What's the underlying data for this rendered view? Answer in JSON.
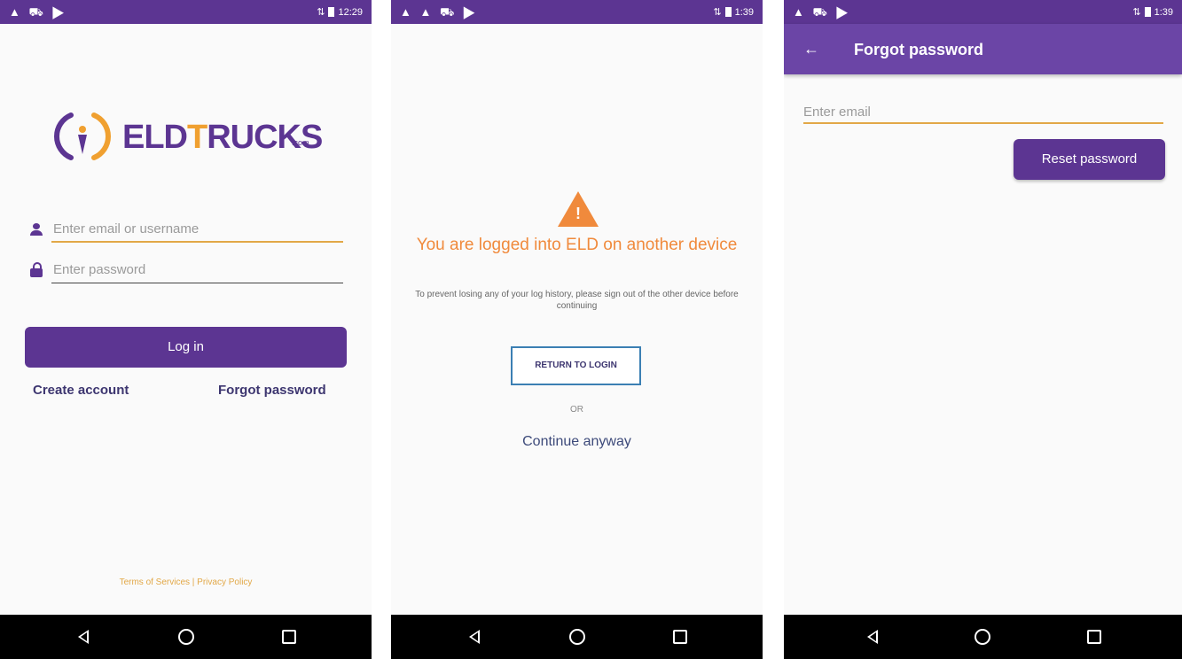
{
  "screens": {
    "login": {
      "status_time": "12:29",
      "logo": {
        "brand": "ELD",
        "brand_accent": "T",
        "brand_rest": "RUCKS",
        "suffix": ".com"
      },
      "email_placeholder": "Enter email or username",
      "password_placeholder": "Enter password",
      "login_button": "Log in",
      "create_account": "Create account",
      "forgot_password": "Forgot password",
      "footer": "Terms of Services | Privacy Policy"
    },
    "logged_in_elsewhere": {
      "status_time": "1:39",
      "title": "You are logged into ELD on another device",
      "subtitle": "To prevent losing any of your log history, please sign out of the other device before continuing",
      "return_button": "RETURN TO LOGIN",
      "or": "OR",
      "continue": "Continue anyway"
    },
    "forgot": {
      "status_time": "1:39",
      "title": "Forgot password",
      "email_placeholder": "Enter email",
      "reset_button": "Reset password"
    }
  },
  "colors": {
    "primary": "#5c3592",
    "accent": "#e2a847",
    "warning": "#f08a3c"
  },
  "icons": [
    "user-icon",
    "lock-icon",
    "warning-icon",
    "back-arrow-icon",
    "nav-back-icon",
    "nav-home-icon",
    "nav-recent-icon"
  ]
}
